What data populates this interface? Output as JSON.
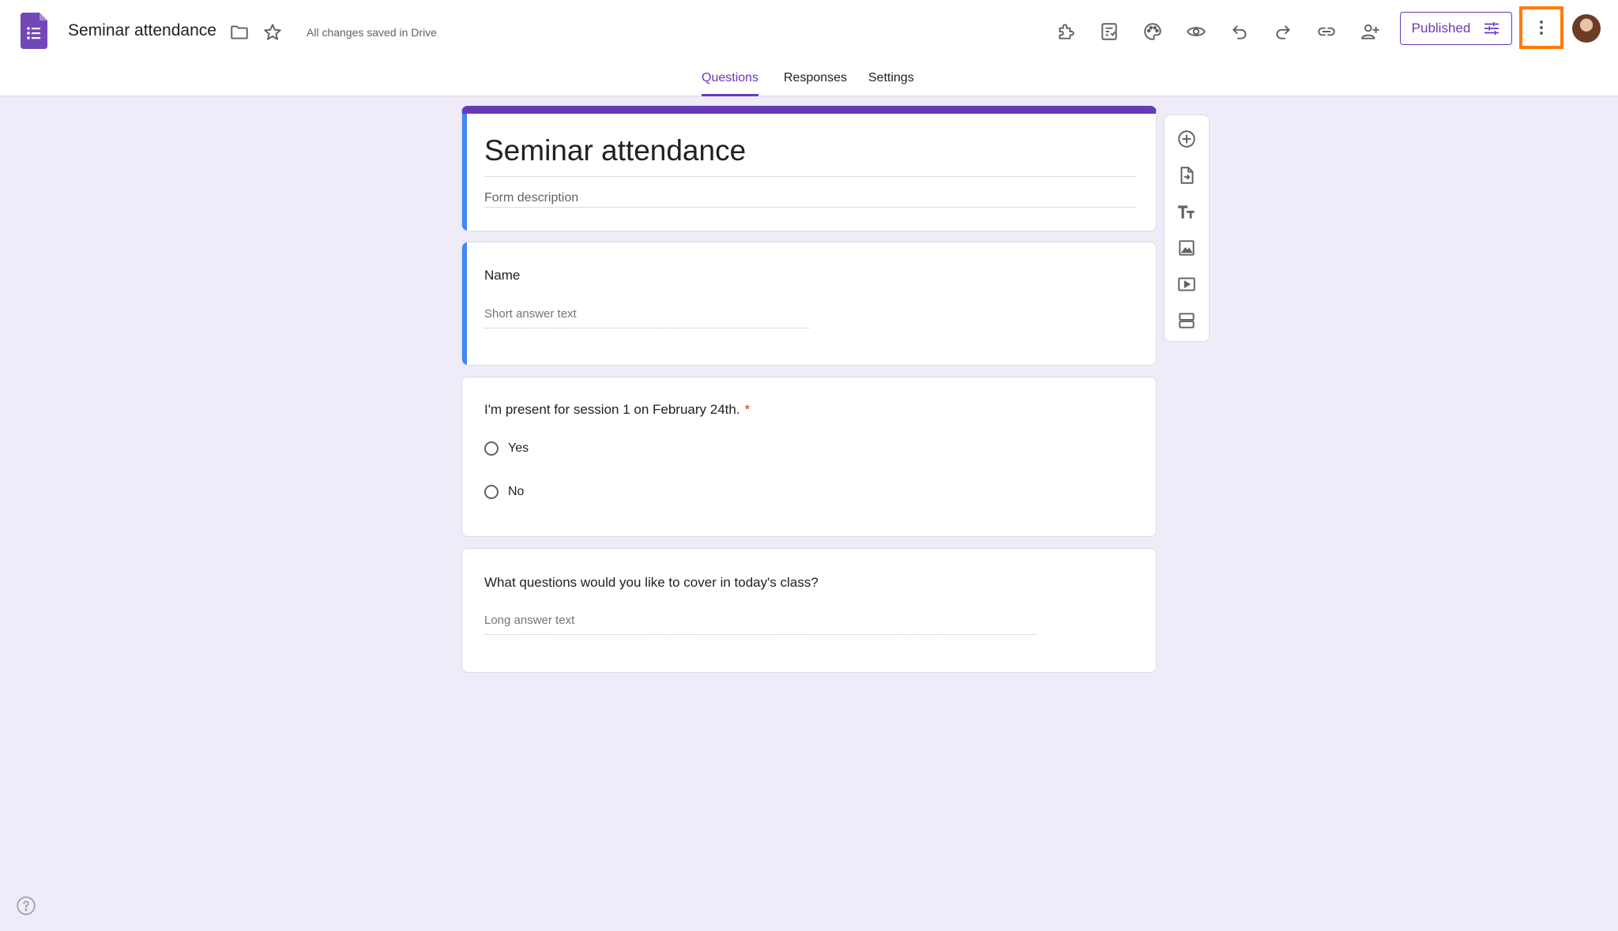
{
  "header": {
    "doc_title": "Seminar attendance",
    "save_status": "All changes saved in Drive",
    "publish_label": "Published",
    "toolbar_icons": [
      "addons-icon",
      "quiz-settings-icon",
      "palette-icon",
      "preview-icon",
      "undo-icon",
      "redo-icon",
      "link-icon",
      "add-collaborator-icon"
    ]
  },
  "tabs": [
    {
      "label": "Questions",
      "active": true
    },
    {
      "label": "Responses",
      "active": false
    },
    {
      "label": "Settings",
      "active": false
    }
  ],
  "form": {
    "title": "Seminar attendance",
    "description_placeholder": "Form description",
    "questions": [
      {
        "title": "Name",
        "type": "short_answer",
        "placeholder": "Short answer text",
        "required": false
      },
      {
        "title": "I'm present for session 1 on February 24th.",
        "type": "multiple_choice",
        "required": true,
        "required_mark": "*",
        "options": [
          "Yes",
          "No"
        ]
      },
      {
        "title": "What questions would you like to cover in today's class?",
        "type": "paragraph",
        "placeholder": "Long answer text",
        "required": false
      }
    ]
  },
  "side_toolbar": [
    "add-question-icon",
    "import-questions-icon",
    "add-title-icon",
    "add-image-icon",
    "add-video-icon",
    "add-section-icon"
  ],
  "colors": {
    "accent": "#673ab7",
    "active_border": "#4285f4",
    "background": "#f0ebf8",
    "highlight": "#ff7b00"
  }
}
